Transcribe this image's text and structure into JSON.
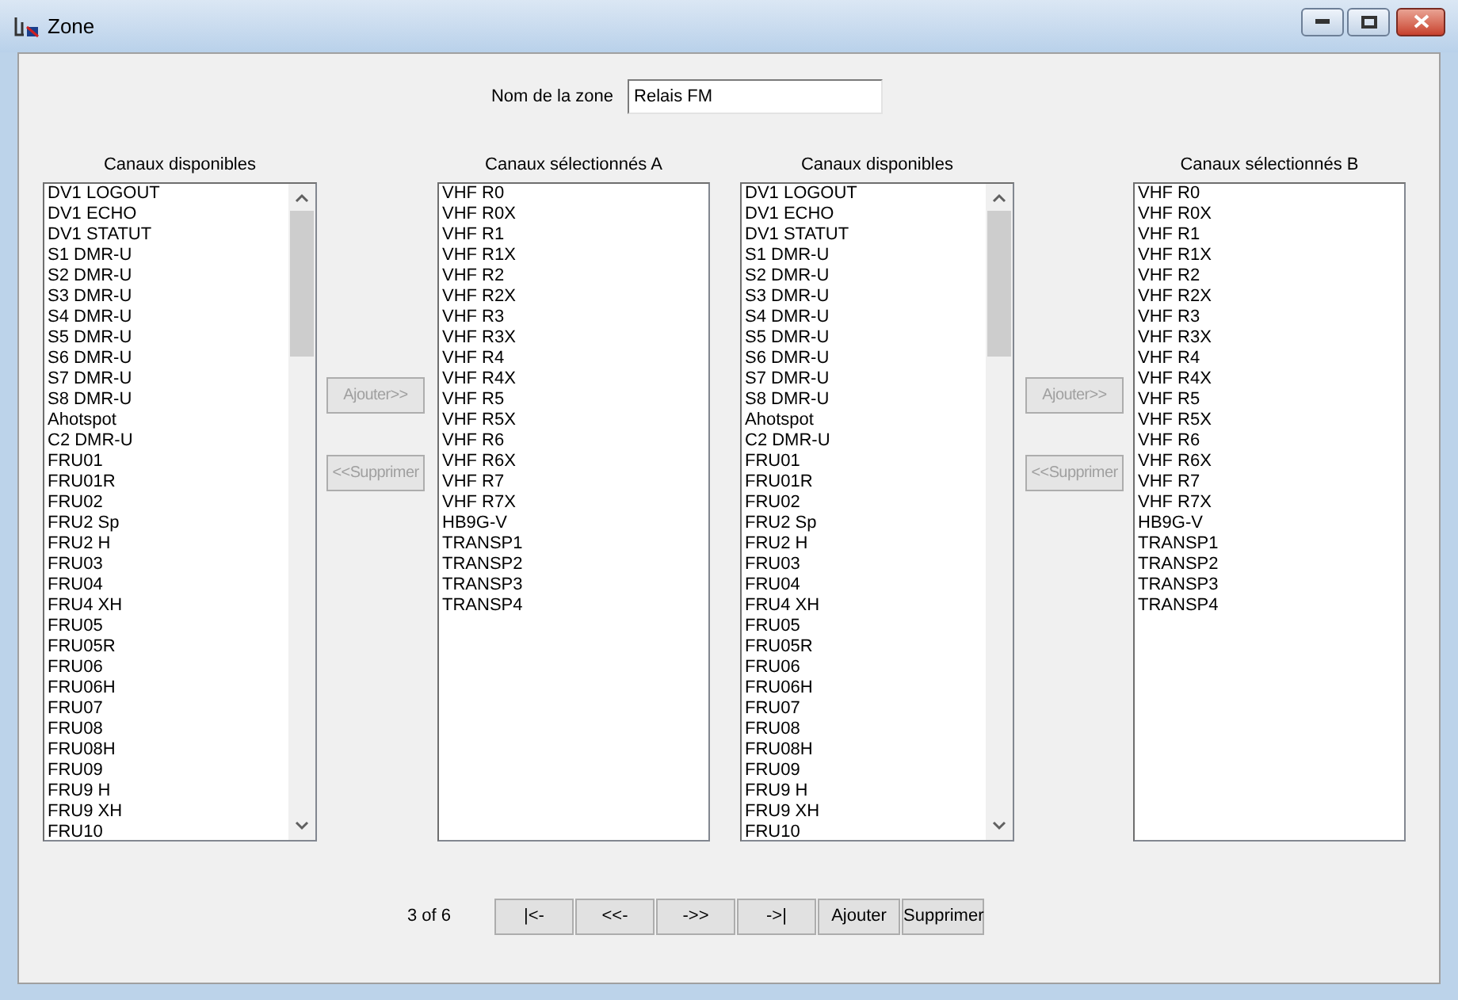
{
  "window": {
    "title": "Zone"
  },
  "zone_name": {
    "label": "Nom de la zone",
    "value": "Relais FM"
  },
  "columns": [
    {
      "kind": "list",
      "label": "Canaux disponibles",
      "scrollbar": true,
      "items": [
        "DV1 LOGOUT",
        "DV1 ECHO",
        "DV1 STATUT",
        "S1 DMR-U",
        "S2 DMR-U",
        "S3 DMR-U",
        "S4 DMR-U",
        "S5 DMR-U",
        "S6 DMR-U",
        "S7 DMR-U",
        "S8 DMR-U",
        "Ahotspot",
        "C2 DMR-U",
        "FRU01",
        "FRU01R",
        "FRU02",
        "FRU2 Sp",
        "FRU2 H",
        "FRU03",
        "FRU04",
        "FRU4 XH",
        "FRU05",
        "FRU05R",
        "FRU06",
        "FRU06H",
        "FRU07",
        "FRU08",
        "FRU08H",
        "FRU09",
        "FRU9 H",
        "FRU9 XH",
        "FRU10"
      ]
    },
    {
      "kind": "buttons",
      "buttons": [
        {
          "label": "Ajouter>>",
          "disabled": true
        },
        {
          "label": "<<Supprimer",
          "disabled": true
        }
      ]
    },
    {
      "kind": "list",
      "label": "Canaux sélectionnés A",
      "scrollbar": false,
      "items": [
        "VHF R0",
        "VHF R0X",
        "VHF R1",
        "VHF R1X",
        "VHF R2",
        "VHF R2X",
        "VHF R3",
        "VHF R3X",
        "VHF R4",
        "VHF R4X",
        "VHF R5",
        "VHF R5X",
        "VHF R6",
        "VHF R6X",
        "VHF R7",
        "VHF R7X",
        "HB9G-V",
        "TRANSP1",
        "TRANSP2",
        "TRANSP3",
        "TRANSP4"
      ]
    },
    {
      "kind": "list",
      "label": "Canaux disponibles",
      "scrollbar": true,
      "items": [
        "DV1 LOGOUT",
        "DV1 ECHO",
        "DV1 STATUT",
        "S1 DMR-U",
        "S2 DMR-U",
        "S3 DMR-U",
        "S4 DMR-U",
        "S5 DMR-U",
        "S6 DMR-U",
        "S7 DMR-U",
        "S8 DMR-U",
        "Ahotspot",
        "C2 DMR-U",
        "FRU01",
        "FRU01R",
        "FRU02",
        "FRU2 Sp",
        "FRU2 H",
        "FRU03",
        "FRU04",
        "FRU4 XH",
        "FRU05",
        "FRU05R",
        "FRU06",
        "FRU06H",
        "FRU07",
        "FRU08",
        "FRU08H",
        "FRU09",
        "FRU9 H",
        "FRU9 XH",
        "FRU10"
      ]
    },
    {
      "kind": "buttons",
      "buttons": [
        {
          "label": "Ajouter>>",
          "disabled": true
        },
        {
          "label": "<<Supprimer",
          "disabled": true
        }
      ]
    },
    {
      "kind": "list",
      "label": "Canaux sélectionnés B",
      "scrollbar": false,
      "items": [
        "VHF R0",
        "VHF R0X",
        "VHF R1",
        "VHF R1X",
        "VHF R2",
        "VHF R2X",
        "VHF R3",
        "VHF R3X",
        "VHF R4",
        "VHF R4X",
        "VHF R5",
        "VHF R5X",
        "VHF R6",
        "VHF R6X",
        "VHF R7",
        "VHF R7X",
        "HB9G-V",
        "TRANSP1",
        "TRANSP2",
        "TRANSP3",
        "TRANSP4"
      ]
    }
  ],
  "pager": {
    "position": "3 of 6",
    "buttons": [
      "|<-",
      "<<-",
      "->>",
      "->|",
      "Ajouter",
      "Supprimer"
    ]
  }
}
